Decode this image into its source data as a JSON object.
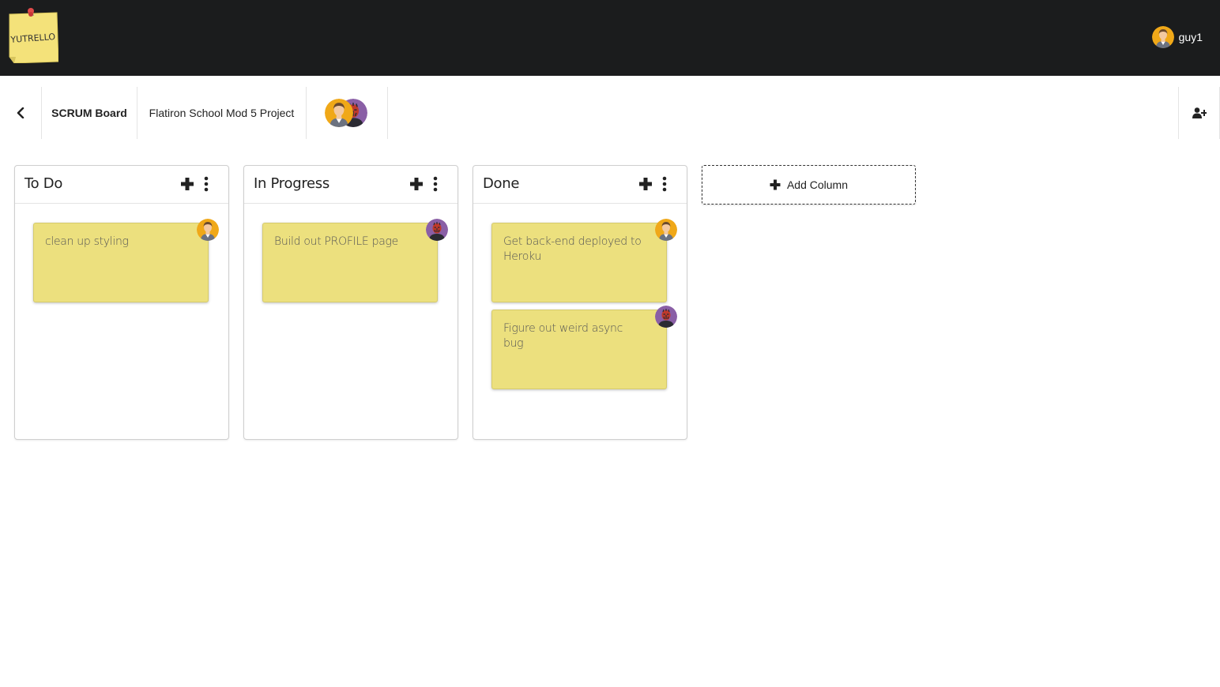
{
  "app": {
    "logo_text": "YUTRELLO",
    "user": {
      "name": "guy1",
      "avatar": "user-guy1-avatar"
    }
  },
  "board": {
    "title": "SCRUM Board",
    "description": "Flatiron School Mod 5 Project",
    "members": [
      "user-guy1-avatar",
      "user-darth-avatar"
    ]
  },
  "columns": [
    {
      "title": "To Do",
      "cards": [
        {
          "text": "clean up styling",
          "assignee": "guy1"
        }
      ]
    },
    {
      "title": "In Progress",
      "cards": [
        {
          "text": "Build out PROFILE page",
          "assignee": "darth"
        }
      ]
    },
    {
      "title": "Done",
      "cards": [
        {
          "text": "Get back-end deployed to Heroku",
          "assignee": "guy1"
        },
        {
          "text": "Figure out weird async bug",
          "assignee": "darth"
        }
      ]
    }
  ],
  "add_column_label": "Add Column",
  "colors": {
    "topbar": "#1b1c1d",
    "card": "#ece07e",
    "avatar_guy1_bg": "#f0a818",
    "avatar_darth_bg": "#8a5fa6"
  },
  "icons": {
    "back": "chevron-left-icon",
    "invite": "user-plus-icon",
    "add_card": "plus-icon",
    "column_menu": "ellipsis-vertical-icon"
  }
}
